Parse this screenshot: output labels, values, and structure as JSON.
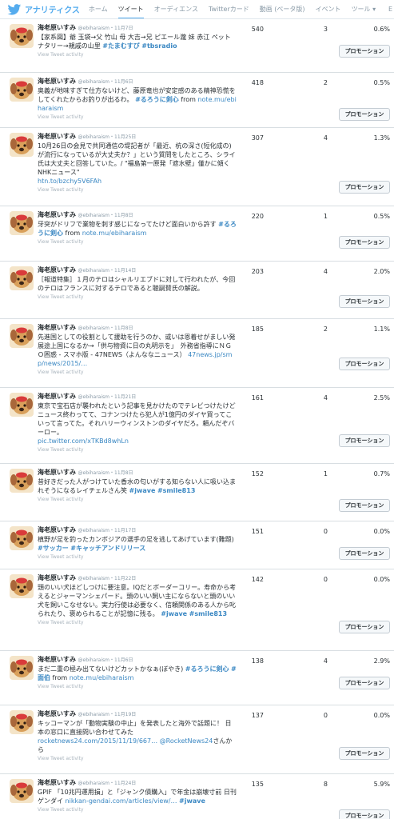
{
  "header": {
    "brand": "アナリティクス",
    "tabs": [
      {
        "label": "ホーム",
        "active": false
      },
      {
        "label": "ツイート",
        "active": true
      },
      {
        "label": "オーディエンス",
        "active": false
      },
      {
        "label": "Twitterカード",
        "active": false
      },
      {
        "label": "動画 (ベータ版)",
        "active": false
      },
      {
        "label": "イベント",
        "active": false
      },
      {
        "label": "ツール",
        "active": false
      }
    ],
    "tools_suffix": "▾",
    "edge_char": "E",
    "brand_color": "#55acee"
  },
  "common": {
    "author_name": "海老原いすみ",
    "author_handle": "@ebiharaism",
    "date_sep": "・",
    "activity_label": "View Tweet activity",
    "promote_label": "プロモーション",
    "link_color": "#3b88c3"
  },
  "tweets": [
    {
      "date": "11月7日",
      "parts": [
        {
          "t": "【家系図】爺 玉袋→父 竹山 母 大吉→兄 ピエール瀧 妹 赤江 ペット ナタリー→親戚の山里 "
        },
        {
          "t": "#たまむすび",
          "k": "tag"
        },
        {
          "t": " "
        },
        {
          "t": "#tbsradio",
          "k": "tag"
        }
      ],
      "impressions": "540",
      "engagements": "3",
      "rate": "0.6%"
    },
    {
      "date": "11月6日",
      "parts": [
        {
          "t": "奥義が地味すぎて仕方ないけど、藤原竜也が安定感のある精神恐慌をしてくれたからお釣りが出るわ。 "
        },
        {
          "t": "#るろうに剣心",
          "k": "tag"
        },
        {
          "t": " from "
        },
        {
          "t": "note.mu/ebiharaism",
          "k": "link"
        }
      ],
      "impressions": "418",
      "engagements": "2",
      "rate": "0.5%"
    },
    {
      "date": "11月25日",
      "parts": [
        {
          "t": "10月26日の会見で共同通信の堤記者が「最近、杭の深さ(短化成の)が流行になっているが大丈夫か？」という質問をしたところ、シライ氏は大丈夫と回答していた。/ \"福島第一原発「遮水壁」僅かに傾く　NHKニュース\"\n"
        },
        {
          "t": "htn.to/bzchy5V6FAh",
          "k": "link"
        }
      ],
      "impressions": "307",
      "engagements": "4",
      "rate": "1.3%"
    },
    {
      "date": "11月8日",
      "parts": [
        {
          "t": "牙突がドリフで業物を刺す感じになってたけど面白いから許す "
        },
        {
          "t": "#るろうに剣心",
          "k": "tag"
        },
        {
          "t": " from "
        },
        {
          "t": "note.mu/ebiharaism",
          "k": "link"
        }
      ],
      "impressions": "220",
      "engagements": "1",
      "rate": "0.5%"
    },
    {
      "date": "11月14日",
      "parts": [
        {
          "t": "［報道特集］１月のテロはシャルリエブドに対して行われたが、今回のテロはフランスに対するテロであると聴嗣賛氏の解説。"
        }
      ],
      "impressions": "203",
      "engagements": "4",
      "rate": "2.0%"
    },
    {
      "date": "11月8日",
      "parts": [
        {
          "t": "先進国としての役割として援助を行うのか、或いは恩着せがましい発展途上国になるか→「供与物資に日の丸明示を」　外務省指導にＮＧＯ困惑 - スマホ版 - 47NEWS（よんななニュース） "
        },
        {
          "t": "47news.jp/smp/news/2015/…",
          "k": "link"
        }
      ],
      "impressions": "185",
      "engagements": "2",
      "rate": "1.1%"
    },
    {
      "date": "11月21日",
      "parts": [
        {
          "t": "東京で宝石店が襲われたという記事を見かけたのでテレビつけたけどニュース終わってて、コナンつけたら犯人が1億円のダイヤ買ってこいって言ってた。それハリーウィンストンのダイヤだろ。頼んだぞバーロー。\n"
        },
        {
          "t": "pic.twitter.com/xTKBd8whLn",
          "k": "link"
        }
      ],
      "impressions": "161",
      "engagements": "4",
      "rate": "2.5%"
    },
    {
      "date": "11月8日",
      "parts": [
        {
          "t": "昔好きだった人がつけていた香水の匂いがする知らない人に吸い込まれそうになるレイチェルさん笑 "
        },
        {
          "t": "#jwave",
          "k": "tag"
        },
        {
          "t": " "
        },
        {
          "t": "#smile813",
          "k": "tag"
        }
      ],
      "impressions": "152",
      "engagements": "1",
      "rate": "0.7%"
    },
    {
      "date": "11月17日",
      "parts": [
        {
          "t": "槙野が足を釣ったカンボジアの選手の足を逃してあげています(難題) "
        },
        {
          "t": "#サッカー",
          "k": "tag"
        },
        {
          "t": " "
        },
        {
          "t": "#キャッチアンドリリース",
          "k": "tag"
        }
      ],
      "impressions": "151",
      "engagements": "0",
      "rate": "0.0%"
    },
    {
      "date": "11月22日",
      "parts": [
        {
          "t": "頭のいい犬ほどしつけに要注意。IQだとボーダーコリー。寿命から考えるとジャーマンシェパード。頭のいい飼い主にならないと頭のいい犬を飼いこなせない。実力行使は必要なく、信頼関係のある人から叱られたり、褒められることが記憶に残る。 "
        },
        {
          "t": "#jwave",
          "k": "tag"
        },
        {
          "t": " "
        },
        {
          "t": "#smile813",
          "k": "tag"
        }
      ],
      "impressions": "142",
      "engagements": "0",
      "rate": "0.0%"
    },
    {
      "date": "11月6日",
      "parts": [
        {
          "t": "まだ二重の極み出てないけどカットかなぁ(ぼやき) "
        },
        {
          "t": "#るろうに剣心",
          "k": "tag"
        },
        {
          "t": " "
        },
        {
          "t": "#面伯",
          "k": "tag"
        },
        {
          "t": " from "
        },
        {
          "t": "note.mu/ebiharaism",
          "k": "link"
        }
      ],
      "impressions": "138",
      "engagements": "4",
      "rate": "2.9%"
    },
    {
      "date": "11月19日",
      "parts": [
        {
          "t": "キッコーマンが「動物実験の中止」を発表したと海外で話題に！ 日本の窓口に直接問い合わせてみた\n"
        },
        {
          "t": "rocketnews24.com/2015/11/19/667…",
          "k": "link"
        },
        {
          "t": " "
        },
        {
          "t": "@RocketNews24",
          "k": "link"
        },
        {
          "t": "さんから"
        }
      ],
      "impressions": "137",
      "engagements": "0",
      "rate": "0.0%"
    },
    {
      "date": "11月24日",
      "parts": [
        {
          "t": "GPIF 「10兆円運用損」と「ジャンク債購入」で年金は崩壊寸前 日刊ゲンダイ "
        },
        {
          "t": "nikkan-gendai.com/articles/view/…",
          "k": "link"
        },
        {
          "t": " "
        },
        {
          "t": "#jwave",
          "k": "tag"
        }
      ],
      "impressions": "135",
      "engagements": "8",
      "rate": "5.9%"
    }
  ]
}
